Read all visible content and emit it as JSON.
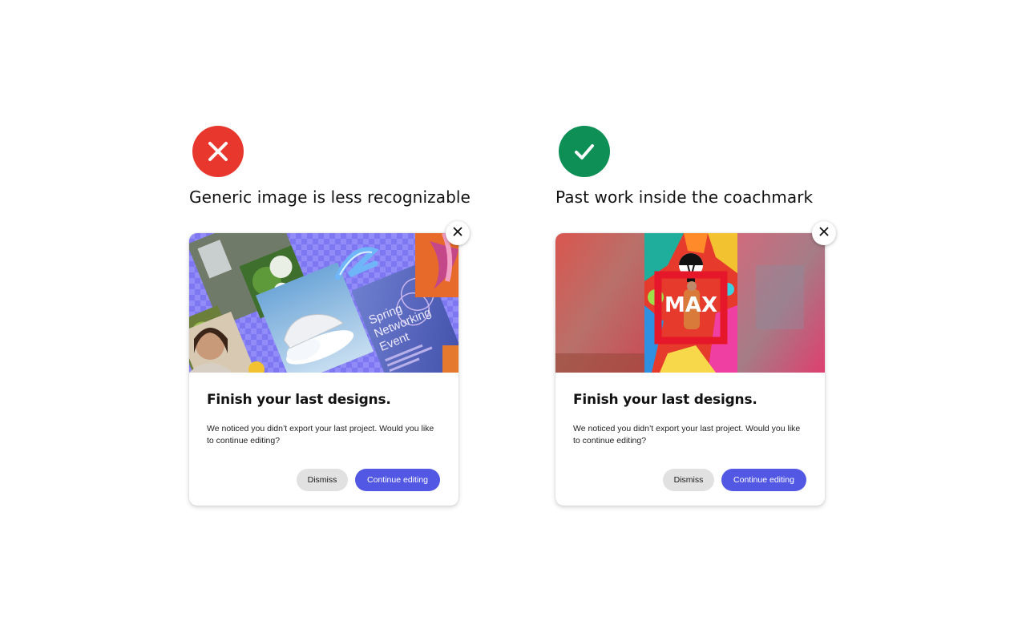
{
  "examples": [
    {
      "verdict": "bad",
      "verdict_icon": "x-icon",
      "verdict_color": "#e8382d",
      "caption": "Generic image is less recognizable",
      "card": {
        "hero_text": [
          "Spring",
          "Networking",
          "Event"
        ],
        "title": "Finish your last designs.",
        "body": "We noticed you didn’t export your last project. Would you like to continue editing?",
        "dismiss_label": "Dismiss",
        "continue_label": "Continue editing"
      }
    },
    {
      "verdict": "good",
      "verdict_icon": "checkmark-icon",
      "verdict_color": "#0d8f55",
      "caption": "Past work inside the coachmark",
      "card": {
        "hero_text": [
          "MAX"
        ],
        "title": "Finish your last designs.",
        "body": "We noticed you didn’t export your last project. Would you like to continue editing?",
        "dismiss_label": "Dismiss",
        "continue_label": "Continue editing"
      }
    }
  ],
  "colors": {
    "primary_button": "#5258e4",
    "secondary_button": "#e1e1e1"
  }
}
